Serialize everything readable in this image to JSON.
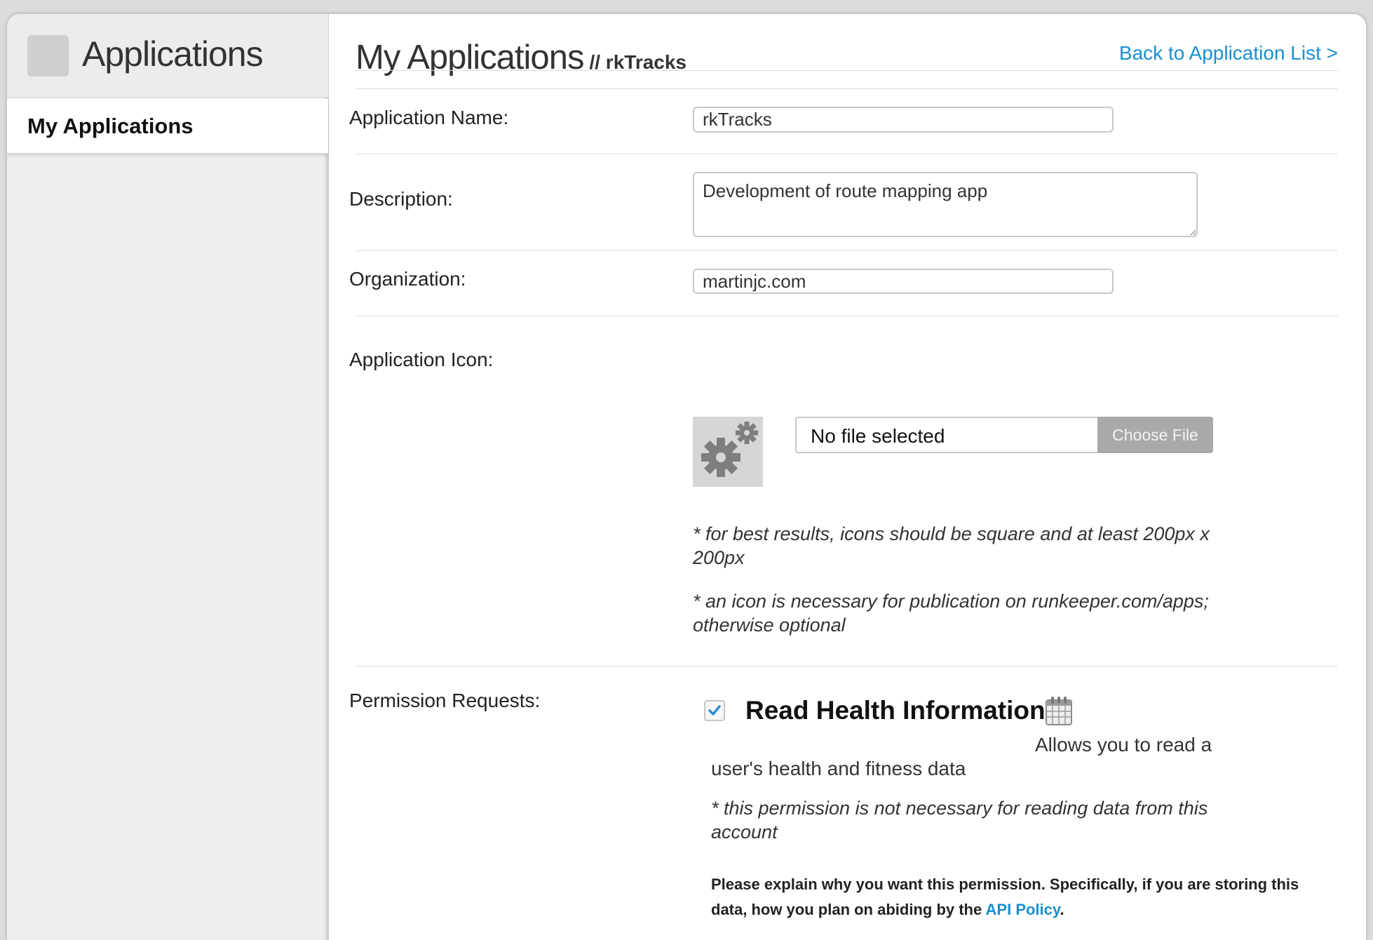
{
  "sidebar": {
    "title": "Applications",
    "items": [
      {
        "label": "My Applications"
      }
    ]
  },
  "header": {
    "title": "My Applications",
    "subtitle": "// rkTracks",
    "back_link": "Back to Application List >"
  },
  "form": {
    "app_name": {
      "label": "Application Name:",
      "value": "rkTracks"
    },
    "description": {
      "label": "Description:",
      "value": "Development of route mapping app"
    },
    "organization": {
      "label": "Organization:",
      "value": "martinjc.com"
    },
    "icon": {
      "label": "Application Icon:",
      "file_status": "No file selected",
      "choose_label": "Choose File",
      "note1": "* for best results, icons should be square and at least 200px x 200px",
      "note2": "* an icon is necessary for publication on runkeeper.com/apps; otherwise optional"
    },
    "permissions": {
      "label": "Permission Requests:",
      "title": "Read Health Information",
      "checked": true,
      "description": "Allows you to read a user's health and fitness data",
      "note": "* this permission is not necessary for reading data from this account",
      "explain_text": "Please explain why you want this permission. Specifically, if you are storing this data, how you plan on abiding by the",
      "policy_link": "API Policy",
      "explain_end": "."
    }
  },
  "colors": {
    "link": "#1a8fd0",
    "sidebar_bg": "#efefef"
  }
}
